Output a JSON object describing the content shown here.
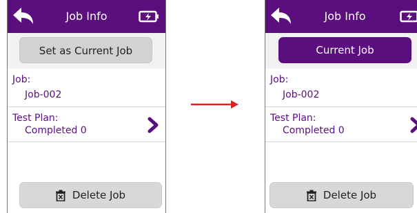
{
  "left_screen": {
    "header": {
      "title": "Job Info",
      "back_icon": "back-arrow-icon",
      "battery_icon": "battery-charging-icon"
    },
    "action_button": {
      "label": "Set as Current Job",
      "style": "inactive"
    },
    "job": {
      "label": "Job:",
      "value": "Job-002"
    },
    "test_plan": {
      "label": "Test Plan:",
      "value": "Completed 0",
      "chevron_icon": "chevron-right-icon"
    },
    "delete_button": {
      "label": "Delete Job",
      "icon": "trash-icon"
    }
  },
  "right_screen": {
    "header": {
      "title": "Job Info",
      "back_icon": "back-arrow-icon",
      "battery_icon": "battery-charging-icon"
    },
    "action_button": {
      "label": "Current Job",
      "style": "active"
    },
    "job": {
      "label": "Job:",
      "value": "Job-002"
    },
    "test_plan": {
      "label": "Test Plan:",
      "value": "Completed 0",
      "chevron_icon": "chevron-right-icon"
    },
    "delete_button": {
      "label": "Delete Job",
      "icon": "trash-icon"
    }
  },
  "transition_arrow": {
    "icon": "right-arrow-icon",
    "color": "#e02020"
  },
  "colors": {
    "brand_purple": "#5b0e7d",
    "button_gray": "#d2d2d2",
    "arrow_red": "#e02020"
  }
}
